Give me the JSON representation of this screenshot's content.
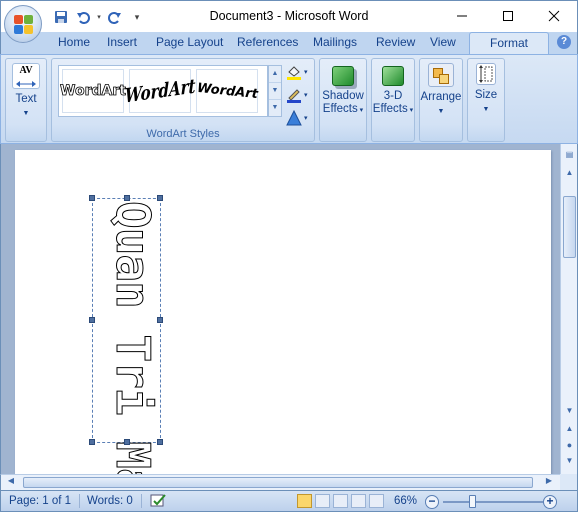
{
  "window": {
    "title": "Document3 - Microsoft Word",
    "minimize_icon": "minimize-icon",
    "maximize_icon": "maximize-icon",
    "close_icon": "close-icon"
  },
  "quick_access": [
    "save-icon",
    "undo-icon",
    "redo-icon",
    "customize-icon"
  ],
  "tabs": [
    "Home",
    "Insert",
    "Page Layout",
    "References",
    "Mailings",
    "Review",
    "View"
  ],
  "active_tab": "Format",
  "ribbon": {
    "text_group": {
      "icon": "AV",
      "label": "Text"
    },
    "wordart_styles": {
      "label": "WordArt Styles",
      "items": [
        "WordArt",
        "WordArt",
        "WordArt"
      ]
    },
    "shadow": {
      "line1": "Shadow",
      "line2": "Effects"
    },
    "threed": {
      "line1": "3-D",
      "line2": "Effects"
    },
    "arrange": {
      "label": "Arrange"
    },
    "size": {
      "label": "Size"
    }
  },
  "document": {
    "wordart_text": "Quan Tri Mang"
  },
  "status": {
    "page": "Page: 1 of 1",
    "words": "Words: 0",
    "zoom": "66%"
  },
  "colors": {
    "accent": "#15428b",
    "ribbon_bg": "#dce8f7",
    "doc_bg": "#a0b4d0"
  }
}
